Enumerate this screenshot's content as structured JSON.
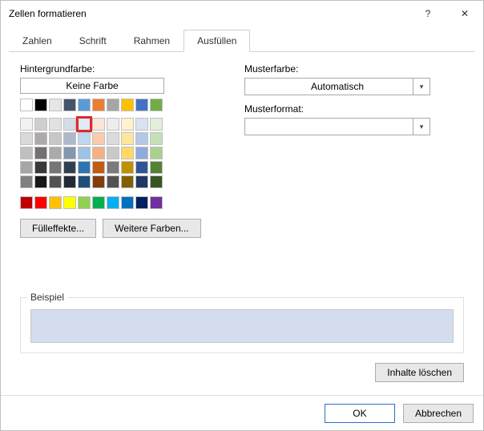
{
  "title": "Zellen formatieren",
  "tabs": {
    "t0": "Zahlen",
    "t1": "Schrift",
    "t2": "Rahmen",
    "t3": "Ausfüllen",
    "active": "Ausfüllen"
  },
  "bgcolor": {
    "label": "Hintergrundfarbe:",
    "nocolor": "Keine Farbe"
  },
  "theme_colors": [
    "#ffffff",
    "#000000",
    "#e7e6e6",
    "#44546a",
    "#5b9bd5",
    "#ed7d31",
    "#a5a5a5",
    "#ffc000",
    "#4472c4",
    "#70ad47"
  ],
  "palette": [
    [
      "#f2f2f2",
      "#d0cece",
      "#e2e2e2",
      "#d6dce5",
      "#deebf7",
      "#fbe5d6",
      "#ededed",
      "#fff2cc",
      "#d9e2f3",
      "#e2efda"
    ],
    [
      "#d9d9d9",
      "#aeaaaa",
      "#c8c6c6",
      "#adb9ca",
      "#bdd7ee",
      "#f8cbad",
      "#dbdbdb",
      "#ffe699",
      "#b4c7e7",
      "#c5e0b4"
    ],
    [
      "#bfbfbf",
      "#757171",
      "#aba9a9",
      "#8497b0",
      "#9dc3e6",
      "#f4b183",
      "#c9c9c9",
      "#ffd966",
      "#8faadc",
      "#a9d18e"
    ],
    [
      "#a6a6a6",
      "#3a3838",
      "#757575",
      "#333f50",
      "#2e75b6",
      "#c55a11",
      "#7b7b7b",
      "#bf9000",
      "#2f5597",
      "#548235"
    ],
    [
      "#808080",
      "#171717",
      "#525252",
      "#222a35",
      "#1f4e79",
      "#843c0c",
      "#525252",
      "#806000",
      "#203864",
      "#375623"
    ]
  ],
  "selected_swatch": {
    "row": 0,
    "col": 4
  },
  "standard_colors": [
    "#c00000",
    "#ff0000",
    "#ffc000",
    "#ffff00",
    "#92d050",
    "#00b050",
    "#00b0f0",
    "#0070c0",
    "#002060",
    "#7030a0"
  ],
  "fill_effects": "Fülleffekte...",
  "more_colors": "Weitere Farben...",
  "pattern_color": {
    "label": "Musterfarbe:",
    "value": "Automatisch"
  },
  "pattern_format": {
    "label": "Musterformat:",
    "value": ""
  },
  "example_label": "Beispiel",
  "preview_color": "#d4ddee",
  "clear_contents": "Inhalte löschen",
  "ok": "OK",
  "cancel": "Abbrechen"
}
